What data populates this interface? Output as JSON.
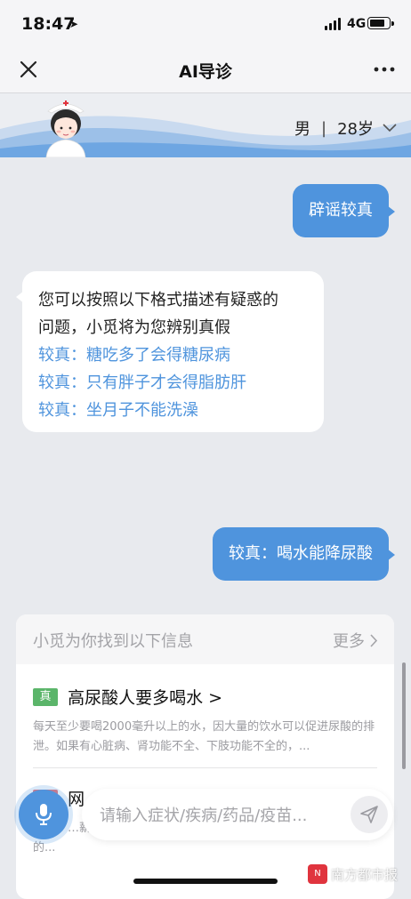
{
  "status_bar": {
    "time": "18:47",
    "network": "4G"
  },
  "nav": {
    "title": "AI导诊",
    "close_icon": "close-icon",
    "more_icon": "more-icon"
  },
  "profile": {
    "gender": "男",
    "separator": "|",
    "age": "28岁"
  },
  "chat": {
    "user_msg_1": "辟谣较真",
    "bot_intro_line1": "您可以按照以下格式描述有疑惑的",
    "bot_intro_line2": "问题，小觅将为您辨别真假",
    "examples": [
      "较真：糖吃多了会得糖尿病",
      "较真：只有胖子才会得脂肪肝",
      "较真：坐月子不能洗澡"
    ],
    "user_msg_2": "较真：喝水能降尿酸"
  },
  "result_card": {
    "header": "小觅为你找到以下信息",
    "more_label": "更多",
    "items": [
      {
        "tag": "真",
        "title": "高尿酸人要多喝水 >",
        "desc": "每天至少要喝2000毫升以上的水，因大量的饮水可以促进尿酸的排泄。如果有心脏病、肾功能不全、下肢功能不全的，..."
      },
      {
        "tag": "",
        "title": "网",
        "desc": "强大，…薪，根本无法引起人体的酸碱变化，更奚现不了降尿酸的..."
      }
    ]
  },
  "input": {
    "placeholder": "请输入症状/疾病/药品/疫苗..."
  },
  "watermark": {
    "logo_text": "N",
    "text": "南方都市报"
  },
  "colors": {
    "accent": "#4f94dd",
    "tag_true": "#5bb56a",
    "background": "#e8eaee"
  }
}
